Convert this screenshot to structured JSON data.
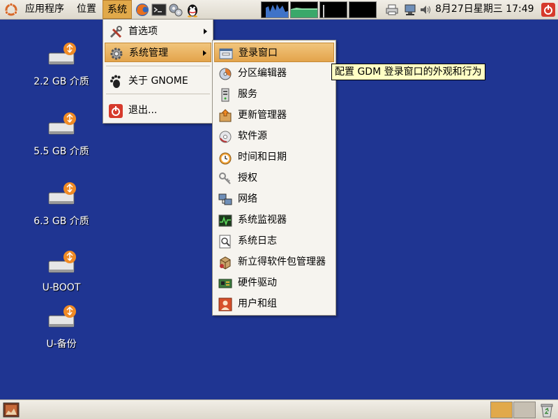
{
  "top_panel": {
    "menus": {
      "applications": "应用程序",
      "places": "位置",
      "system": "系统"
    },
    "launchers": [
      "firefox-icon",
      "terminal-icon",
      "gear-tool-icon",
      "qq-penguin-icon"
    ],
    "clock": "8月27日星期三 17:49"
  },
  "desktop": {
    "icons": [
      {
        "label": "2.2 GB 介质"
      },
      {
        "label": "5.5 GB 介质"
      },
      {
        "label": "6.3 GB 介质"
      },
      {
        "label": "U-BOOT"
      },
      {
        "label": "U-备份"
      }
    ]
  },
  "system_menu": {
    "items": [
      {
        "label": "首选项",
        "icon": "preferences-icon",
        "submenu": true
      },
      {
        "label": "系统管理",
        "icon": "administration-gear-icon",
        "submenu": true,
        "highlighted": true
      },
      {
        "label": "关于 GNOME",
        "icon": "gnome-foot-icon"
      },
      {
        "label": "退出...",
        "icon": "logout-icon"
      }
    ]
  },
  "admin_menu": {
    "items": [
      {
        "label": "登录窗口",
        "icon": "login-window-icon",
        "highlighted": true
      },
      {
        "label": "分区编辑器",
        "icon": "partition-editor-icon"
      },
      {
        "label": "服务",
        "icon": "services-icon"
      },
      {
        "label": "更新管理器",
        "icon": "update-manager-icon"
      },
      {
        "label": "软件源",
        "icon": "software-sources-icon"
      },
      {
        "label": "时间和日期",
        "icon": "clock-icon"
      },
      {
        "label": "授权",
        "icon": "keys-icon"
      },
      {
        "label": "网络",
        "icon": "network-icon"
      },
      {
        "label": "系统监视器",
        "icon": "system-monitor-icon"
      },
      {
        "label": "系统日志",
        "icon": "system-log-icon"
      },
      {
        "label": "新立得软件包管理器",
        "icon": "synaptic-icon"
      },
      {
        "label": "硬件驱动",
        "icon": "hardware-drivers-icon"
      },
      {
        "label": "用户和组",
        "icon": "users-groups-icon"
      }
    ]
  },
  "tooltip": "配置 GDM 登录窗口的外观和行为",
  "colors": {
    "desktop": "#1f3592",
    "panel": "#e8e4dc",
    "highlight": "#e3a44b",
    "tooltip_bg": "#ffffc4"
  }
}
